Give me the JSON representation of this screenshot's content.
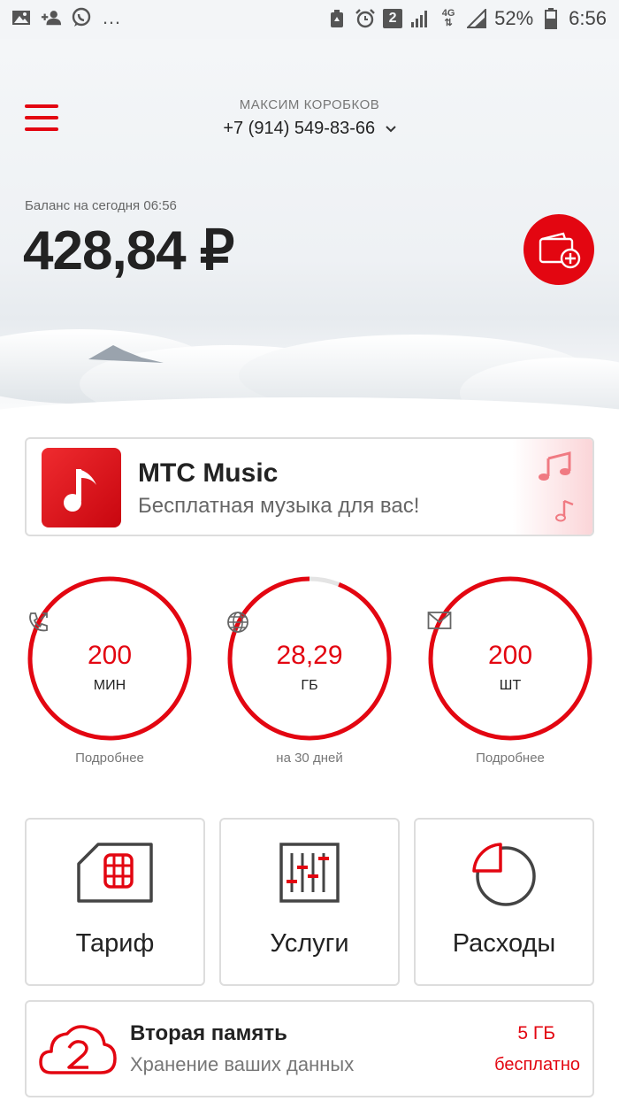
{
  "status_bar": {
    "battery": "52%",
    "time": "6:56",
    "sim_slot": "2",
    "network": "4G",
    "left_icons": [
      "image-icon",
      "add-contact-icon",
      "whatsapp-icon",
      "more-dots-icon"
    ],
    "right_icons": [
      "storage-cleaner-icon",
      "alarm-icon",
      "sim-icon",
      "signal-icon",
      "lte-icon",
      "signal-icon",
      "battery-icon"
    ]
  },
  "header": {
    "owner_name": "МАКСИМ КОРОБКОВ",
    "phone_number": "+7 (914) 549-83-66"
  },
  "balance": {
    "label": "Баланс на сегодня 06:56",
    "amount": "428,84 ₽"
  },
  "music_banner": {
    "title": "МТС Music",
    "subtitle": "Бесплатная музыка для вас!"
  },
  "counters": [
    {
      "value": "200",
      "unit": "МИН",
      "note": "Подробнее",
      "icon": "phone-outgoing-icon",
      "remaining_fraction": 1.0
    },
    {
      "value": "28,29",
      "unit": "ГБ",
      "note": "на 30 дней",
      "icon": "globe-icon",
      "remaining_fraction": 0.94
    },
    {
      "value": "200",
      "unit": "ШТ",
      "note": "Подробнее",
      "icon": "envelope-icon",
      "remaining_fraction": 1.0
    }
  ],
  "tiles": [
    {
      "label": "Тариф",
      "icon": "sim-card-icon"
    },
    {
      "label": "Услуги",
      "icon": "sliders-icon"
    },
    {
      "label": "Расходы",
      "icon": "pie-chart-icon"
    }
  ],
  "storage": {
    "title": "Вторая память",
    "subtitle": "Хранение ваших данных",
    "size": "5 ГБ",
    "price": "бесплатно"
  },
  "colors": {
    "accent": "#e30611",
    "text": "#222222",
    "muted": "#777777",
    "border": "#dddddd"
  }
}
